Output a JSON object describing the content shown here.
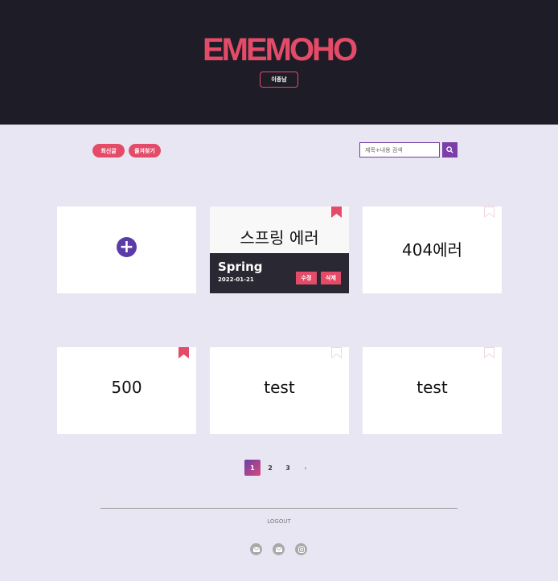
{
  "header": {
    "logo": "EMEMOHO",
    "user_button": "이종남"
  },
  "toolbar": {
    "latest_label": "최신글",
    "favorites_label": "즐겨찾기",
    "search_placeholder": "제목+내용 검색"
  },
  "cards": [
    {
      "type": "add",
      "bookmarked": false
    },
    {
      "type": "expanded",
      "title": "스프링 에러",
      "subtitle": "Spring",
      "date": "2022-01-21",
      "edit_label": "수정",
      "delete_label": "삭제",
      "bookmarked": true
    },
    {
      "type": "note",
      "title": "404에러",
      "bookmarked": false
    },
    {
      "type": "note",
      "title": "500",
      "bookmarked": true
    },
    {
      "type": "note",
      "title": "test",
      "bookmarked": false
    },
    {
      "type": "note",
      "title": "test",
      "bookmarked": false
    }
  ],
  "pagination": {
    "pages": [
      "1",
      "2",
      "3"
    ],
    "current": "1",
    "next": "›"
  },
  "footer": {
    "logout": "LOGOUT"
  },
  "colors": {
    "accent": "#e44b68",
    "header_bg": "#1e1d27",
    "page_bg": "#e9e6f4",
    "purple": "#5b3ba8"
  }
}
